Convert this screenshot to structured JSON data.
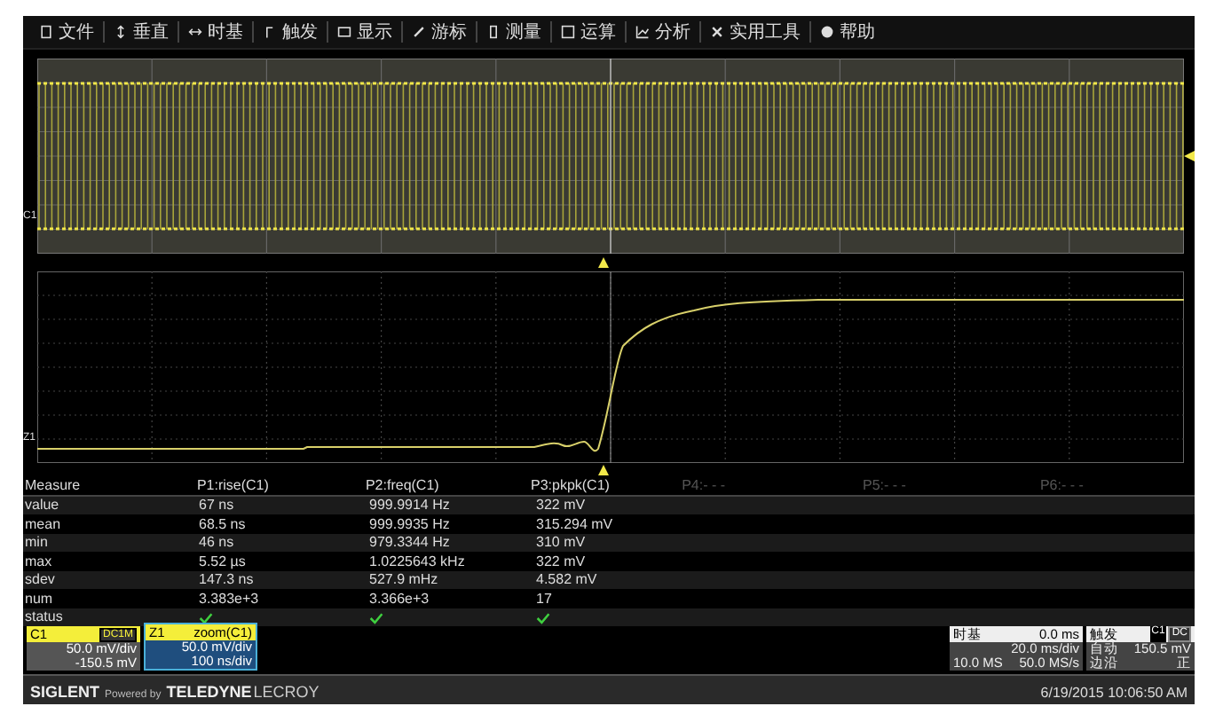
{
  "menu": [
    {
      "label": "文件"
    },
    {
      "label": "垂直"
    },
    {
      "label": "时基"
    },
    {
      "label": "触发"
    },
    {
      "label": "显示"
    },
    {
      "label": "游标"
    },
    {
      "label": "测量"
    },
    {
      "label": "运算"
    },
    {
      "label": "分析"
    },
    {
      "label": "实用工具"
    },
    {
      "label": "帮助"
    }
  ],
  "overview": {
    "channel_label": "C1"
  },
  "zoom_view": {
    "channel_label": "Z1"
  },
  "measure": {
    "columns": [
      "Measure",
      "P1:rise(C1)",
      "P2:freq(C1)",
      "P3:pkpk(C1)",
      "P4:- - -",
      "P5:- - -",
      "P6:- - -"
    ],
    "rows": [
      {
        "kind": "text",
        "label": "value",
        "cells": [
          "67 ns",
          "999.9914 Hz",
          "322 mV"
        ]
      },
      {
        "kind": "text",
        "label": "mean",
        "cells": [
          "68.5 ns",
          "999.9935 Hz",
          "315.294 mV"
        ]
      },
      {
        "kind": "text",
        "label": "min",
        "cells": [
          "46 ns",
          "979.3344 Hz",
          "310 mV"
        ]
      },
      {
        "kind": "text",
        "label": "max",
        "cells": [
          "5.52 µs",
          "1.0225643 kHz",
          "322 mV"
        ]
      },
      {
        "kind": "text",
        "label": "sdev",
        "cells": [
          "147.3 ns",
          "527.9 mHz",
          "4.582 mV"
        ]
      },
      {
        "kind": "text",
        "label": "num",
        "cells": [
          "3.383e+3",
          "3.366e+3",
          "17"
        ]
      },
      {
        "kind": "status",
        "label": "status",
        "passed": [
          true,
          true,
          true
        ]
      }
    ]
  },
  "channels": [
    {
      "kind": "channel",
      "name": "C1",
      "badge": "DC1M",
      "lines": [
        "50.0 mV/div",
        "-150.5 mV"
      ]
    },
    {
      "kind": "zoom",
      "name": "Z1",
      "source": "zoom(C1)",
      "lines": [
        "50.0 mV/div",
        "100 ns/div"
      ]
    }
  ],
  "timebase": {
    "title": "时基",
    "delay": "0.0 ms",
    "scale": "20.0 ms/div",
    "memory": "10.0 MS",
    "rate": "50.0 MS/s"
  },
  "trigger": {
    "title": "触发",
    "source": "C1",
    "coupling": "DC",
    "mode": "自动",
    "level": "150.5 mV",
    "type": "边沿",
    "slope": "正"
  },
  "footer": {
    "brand": "SIGLENT",
    "powered": "Powered by",
    "partner": "TELEDYNE",
    "partner_suffix": "LECROY",
    "datetime": "6/19/2015 10:06:50 AM"
  }
}
